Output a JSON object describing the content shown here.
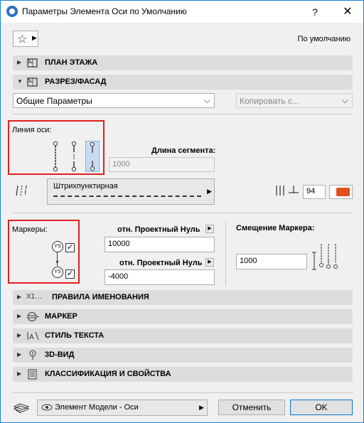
{
  "window": {
    "title": "Параметры Элемента Оси по Умолчанию",
    "help_label": "?",
    "close_label": "✕"
  },
  "header": {
    "default_label": "По умолчанию",
    "favorites_icon": "star-icon"
  },
  "sections": {
    "floor_plan": {
      "label": "ПЛАН ЭТАЖА",
      "expanded": false
    },
    "section_elevation": {
      "label": "РАЗРЕЗ/ФАСАД",
      "expanded": true
    },
    "naming_rules": {
      "label": "ПРАВИЛА ИМЕНОВАНИЯ",
      "icon_text": "X1…"
    },
    "marker": {
      "label": "МАРКЕР"
    },
    "text_style": {
      "label": "СТИЛЬ ТЕКСТА"
    },
    "view_3d": {
      "label": "3D-ВИД"
    },
    "classification": {
      "label": "КЛАССИФИКАЦИЯ И СВОЙСТВА"
    }
  },
  "panel": {
    "general_select": "Общие Параметры",
    "copy_select": "Копировать с...",
    "axis_line_label": "Линия оси:",
    "segment_length_label": "Длина сегмента:",
    "segment_length_value": "1000",
    "linetype_name": "Штрихпунктирная",
    "pen_value": "94",
    "pen_color": "#e0501c",
    "markers_label": "Маркеры:",
    "marker_badge": "YS",
    "top_ref_label": "отн. Проектный Нуль",
    "top_ref_value": "10000",
    "bottom_ref_label": "отн. Проектный Нуль",
    "bottom_ref_value": "-4000",
    "offset_label": "Смещение Маркера:",
    "offset_value": "1000",
    "check_mark": "✓"
  },
  "footer": {
    "layer_select": "Элемент Модели - Оси",
    "cancel_label": "Отменить",
    "ok_label": "OK"
  },
  "colors": {
    "accent_border": "#1883d7",
    "highlight_red": "#e0201c",
    "selected_bg": "#c7dcf2"
  }
}
